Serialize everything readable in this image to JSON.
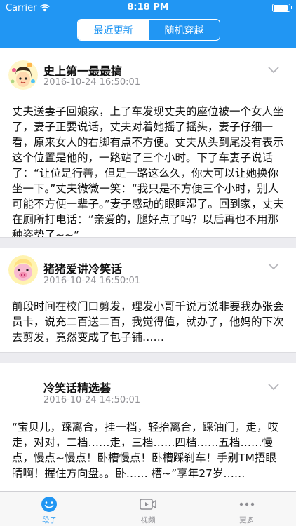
{
  "status": {
    "carrier": "Carrier",
    "time": "8:18 PM"
  },
  "segments": [
    {
      "label": "最近更新",
      "active": true
    },
    {
      "label": "随机穿越",
      "active": false
    }
  ],
  "posts": [
    {
      "author": "史上第一最最搞",
      "date": "2016-10-24 16:50:01",
      "content": "丈夫送妻子回娘家，上了车发现丈夫的座位被一个女人坐了，妻子正要说话，丈夫对着她摇了摇头，妻子仔细一看，原来女人的右脚有点不方便。丈夫从头到尾没有表示这个位置是他的，一路站了三个小时。下了车妻子说话了：“让位是行善，但是一路这么久，你大可以让她换你坐一下。”丈夫微微一笑：“我只是不方便三个小时，别人可能不方便一辈子。”妻子感动的眼眶湿了。回到家，丈夫在厕所打电话：“亲爱的，腿好点了吗？以后再也不用那种姿势了~~”"
    },
    {
      "author": "猪猪爱讲冷笑话",
      "date": "2016-10-24 16:50:01",
      "content": "前段时间在校门口剪发，理发小哥千说万说非要我办张会员卡，说充二百送二百，我觉得值，就办了，他妈的下次去剪发，竟然变成了包子铺……"
    },
    {
      "author": "冷笑话精选荟",
      "date": "2016-10-24 14:50:01",
      "content": "“宝贝儿，踩离合，挂一档，轻抬离合，踩油门，走，哎走，对对，二档……走，三档……四档……五档……慢点，慢点~慢点！卧槽慢点！卧槽踩刹车！手别TM捂眼睛啊！握住方向盘。。卧…… 槽~”享年27岁……"
    }
  ],
  "tabs": [
    {
      "label": "段子",
      "icon": "smiley-icon",
      "active": true
    },
    {
      "label": "视频",
      "icon": "video-icon",
      "active": false
    },
    {
      "label": "更多",
      "icon": "more-dots-icon",
      "active": false
    }
  ],
  "colors": {
    "accent": "#2196f3",
    "inactive": "#8e8e93",
    "text": "#111111",
    "meta": "#8e8e93"
  }
}
